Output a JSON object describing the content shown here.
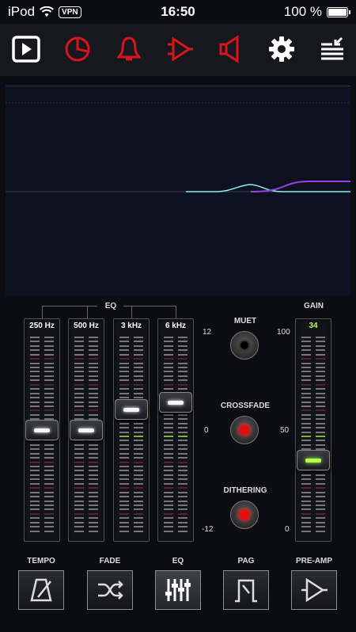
{
  "status": {
    "carrier": "iPod",
    "vpn": "VPN",
    "time": "16:50",
    "battery": "100 %"
  },
  "toolbar": {
    "items": [
      {
        "name": "play",
        "icon": "play-icon",
        "active": true
      },
      {
        "name": "timer",
        "icon": "pie-timer-icon",
        "active": false
      },
      {
        "name": "alarm",
        "icon": "bell-icon",
        "active": false
      },
      {
        "name": "output",
        "icon": "amp-icon",
        "active": false
      },
      {
        "name": "speaker",
        "icon": "speaker-icon",
        "active": false
      },
      {
        "name": "settings",
        "icon": "gear-icon",
        "active": false
      },
      {
        "name": "queue",
        "icon": "queue-icon",
        "active": false
      }
    ],
    "accent": "#d8141c"
  },
  "eq": {
    "label": "EQ",
    "bands": [
      {
        "freq": "250 Hz",
        "level": 0.5
      },
      {
        "freq": "500 Hz",
        "level": 0.5
      },
      {
        "freq": "3 kHz",
        "level": 0.61
      },
      {
        "freq": "6 kHz",
        "level": 0.65
      }
    ],
    "scale": {
      "top": "12",
      "mid": "0",
      "bottom": "-12"
    }
  },
  "toggles": {
    "muet": {
      "label": "MUET",
      "on": false
    },
    "crossfade": {
      "label": "CROSSFADE",
      "on": true
    },
    "dithering": {
      "label": "DITHERING",
      "on": true
    }
  },
  "gain": {
    "label": "GAIN",
    "value": "34",
    "level": 0.34,
    "scale": {
      "top": "100",
      "mid": "50",
      "bottom": "0"
    }
  },
  "bottom": {
    "items": [
      {
        "label": "TEMPO",
        "icon": "metronome-icon",
        "active": false
      },
      {
        "label": "FADE",
        "icon": "shuffle-icon",
        "active": false
      },
      {
        "label": "EQ",
        "icon": "sliders-icon",
        "active": true
      },
      {
        "label": "PAG",
        "icon": "pag-icon",
        "active": false
      },
      {
        "label": "PRE-AMP",
        "icon": "preamp-icon",
        "active": false
      }
    ]
  }
}
